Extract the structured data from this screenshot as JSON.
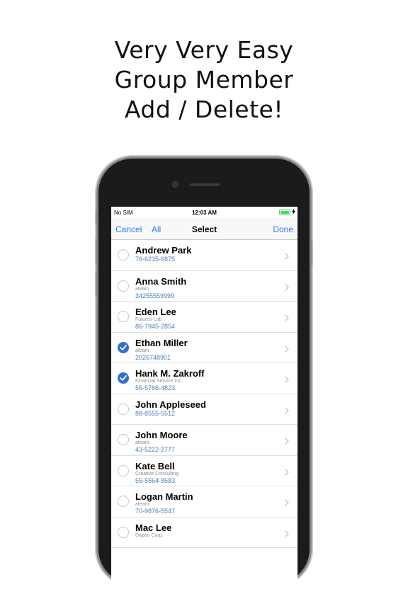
{
  "headline": {
    "line1": "Very Very Easy",
    "line2": "Group Member",
    "line3": "Add / Delete!"
  },
  "status_bar": {
    "carrier": "No SIM",
    "time": "12:03 AM",
    "battery_level": 1.0
  },
  "nav": {
    "cancel_label": "Cancel",
    "all_label": "All",
    "title": "Select",
    "done_label": "Done"
  },
  "contacts": [
    {
      "name": "Andrew Park",
      "org": "",
      "phone": "76-6235-6875",
      "selected": false
    },
    {
      "name": "Anna Smith",
      "org": "ateam",
      "phone": "34255559999",
      "selected": false
    },
    {
      "name": "Eden Lee",
      "org": "Futures Lab",
      "phone": "86-7945-2854",
      "selected": false
    },
    {
      "name": "Ethan Miller",
      "org": "ateam",
      "phone": "2026748901",
      "selected": true
    },
    {
      "name": "Hank M. Zakroff",
      "org": "Financial Service Inc.",
      "phone": "55-5766-4823",
      "selected": true
    },
    {
      "name": "John Appleseed",
      "org": "",
      "phone": "88-8555-5512",
      "selected": false
    },
    {
      "name": "John Moore",
      "org": "ateam",
      "phone": "43-5222-2777",
      "selected": false
    },
    {
      "name": "Kate Bell",
      "org": "Creative Consulting",
      "phone": "55-5564-8583",
      "selected": false
    },
    {
      "name": "Logan Martin",
      "org": "ateam",
      "phone": "70-9876-5547",
      "selected": false
    },
    {
      "name": "Mac Lee",
      "org": "Dapao Corp.",
      "phone": "",
      "selected": false
    }
  ],
  "colors": {
    "accent": "#2a7ef7",
    "selected": "#2f6fd0",
    "phone_text": "#4a7fb5",
    "battery": "#4cd964"
  },
  "icons": {
    "check": "checkmark-icon",
    "row_disclosure": "chevron-right-icon",
    "charging": "bolt-icon"
  }
}
